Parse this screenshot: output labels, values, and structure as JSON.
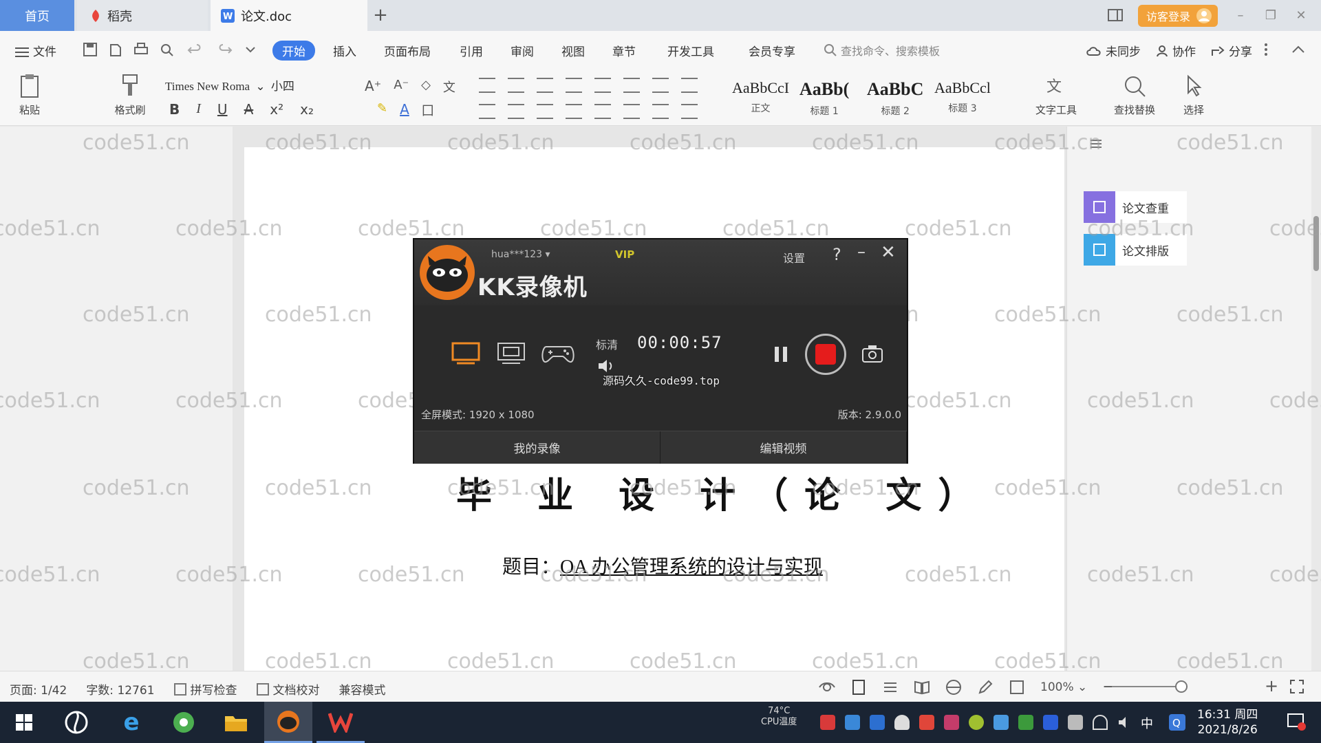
{
  "tabs": {
    "home": "首页",
    "daoke": "稻壳",
    "document": "论文.doc",
    "add": "+"
  },
  "window": {
    "visitor_login": "访客登录"
  },
  "menu": {
    "file": "文件",
    "start": "开始",
    "insert": "插入",
    "layout": "页面布局",
    "reference": "引用",
    "review": "审阅",
    "view": "视图",
    "chapter": "章节",
    "developer": "开发工具",
    "member": "会员专享",
    "search_cmd": "查找命令、搜索模板",
    "not_synced": "未同步",
    "collaborate": "协作",
    "share": "分享"
  },
  "ribbon": {
    "paste": "粘贴",
    "format_painter": "格式刷",
    "font_name": "Times New Roma",
    "font_size": "小四",
    "bold": "B",
    "italic": "I",
    "underline": "U",
    "strike": "A",
    "styles": [
      {
        "sample": "AaBbCcI",
        "name": "正文",
        "bold": false
      },
      {
        "sample": "AaBb(",
        "name": "标题 1",
        "bold": true
      },
      {
        "sample": "AaBbC",
        "name": "标题 2",
        "bold": true
      },
      {
        "sample": "AaBbCcl",
        "name": "标题 3",
        "bold": false
      }
    ],
    "text_tools": "文字工具",
    "find_replace": "查找替换",
    "select": "选择"
  },
  "right_panel": {
    "check": "论文查重",
    "format": "论文排版"
  },
  "document": {
    "title": "毕 业 设 计（论 文）",
    "subject_label": "题目：",
    "subject": "OA 办公管理系统的设计与实现"
  },
  "watermark": "code51.cn",
  "kk": {
    "user": "hua***123",
    "vip": "VIP",
    "brand": "KK录像机",
    "settings": "设置",
    "help": "?",
    "min": "–",
    "close": "✕",
    "quality": "标清",
    "time": "00:00:57",
    "overlay": "源码久久-code99.top",
    "mode_info": "全屏模式: 1920 x 1080",
    "version": "版本: 2.9.0.0",
    "my_recordings": "我的录像",
    "edit_video": "编辑视频"
  },
  "status": {
    "page": "页面: 1/42",
    "words": "字数: 12761",
    "spell": "拼写检查",
    "proof": "文档校对",
    "compat": "兼容模式",
    "zoom": "100%",
    "minus": "−",
    "plus": "+"
  },
  "taskbar": {
    "cpu_temp": "74°C",
    "cpu_label": "CPU温度",
    "lang": "中",
    "time": "16:31 周四",
    "date": "2021/8/26"
  },
  "colors": {
    "accent": "#3d7be8",
    "home_tab": "#5a8fe0",
    "login": "#f2a23a",
    "record": "#e51c1c",
    "vip": "#d1c52c"
  }
}
